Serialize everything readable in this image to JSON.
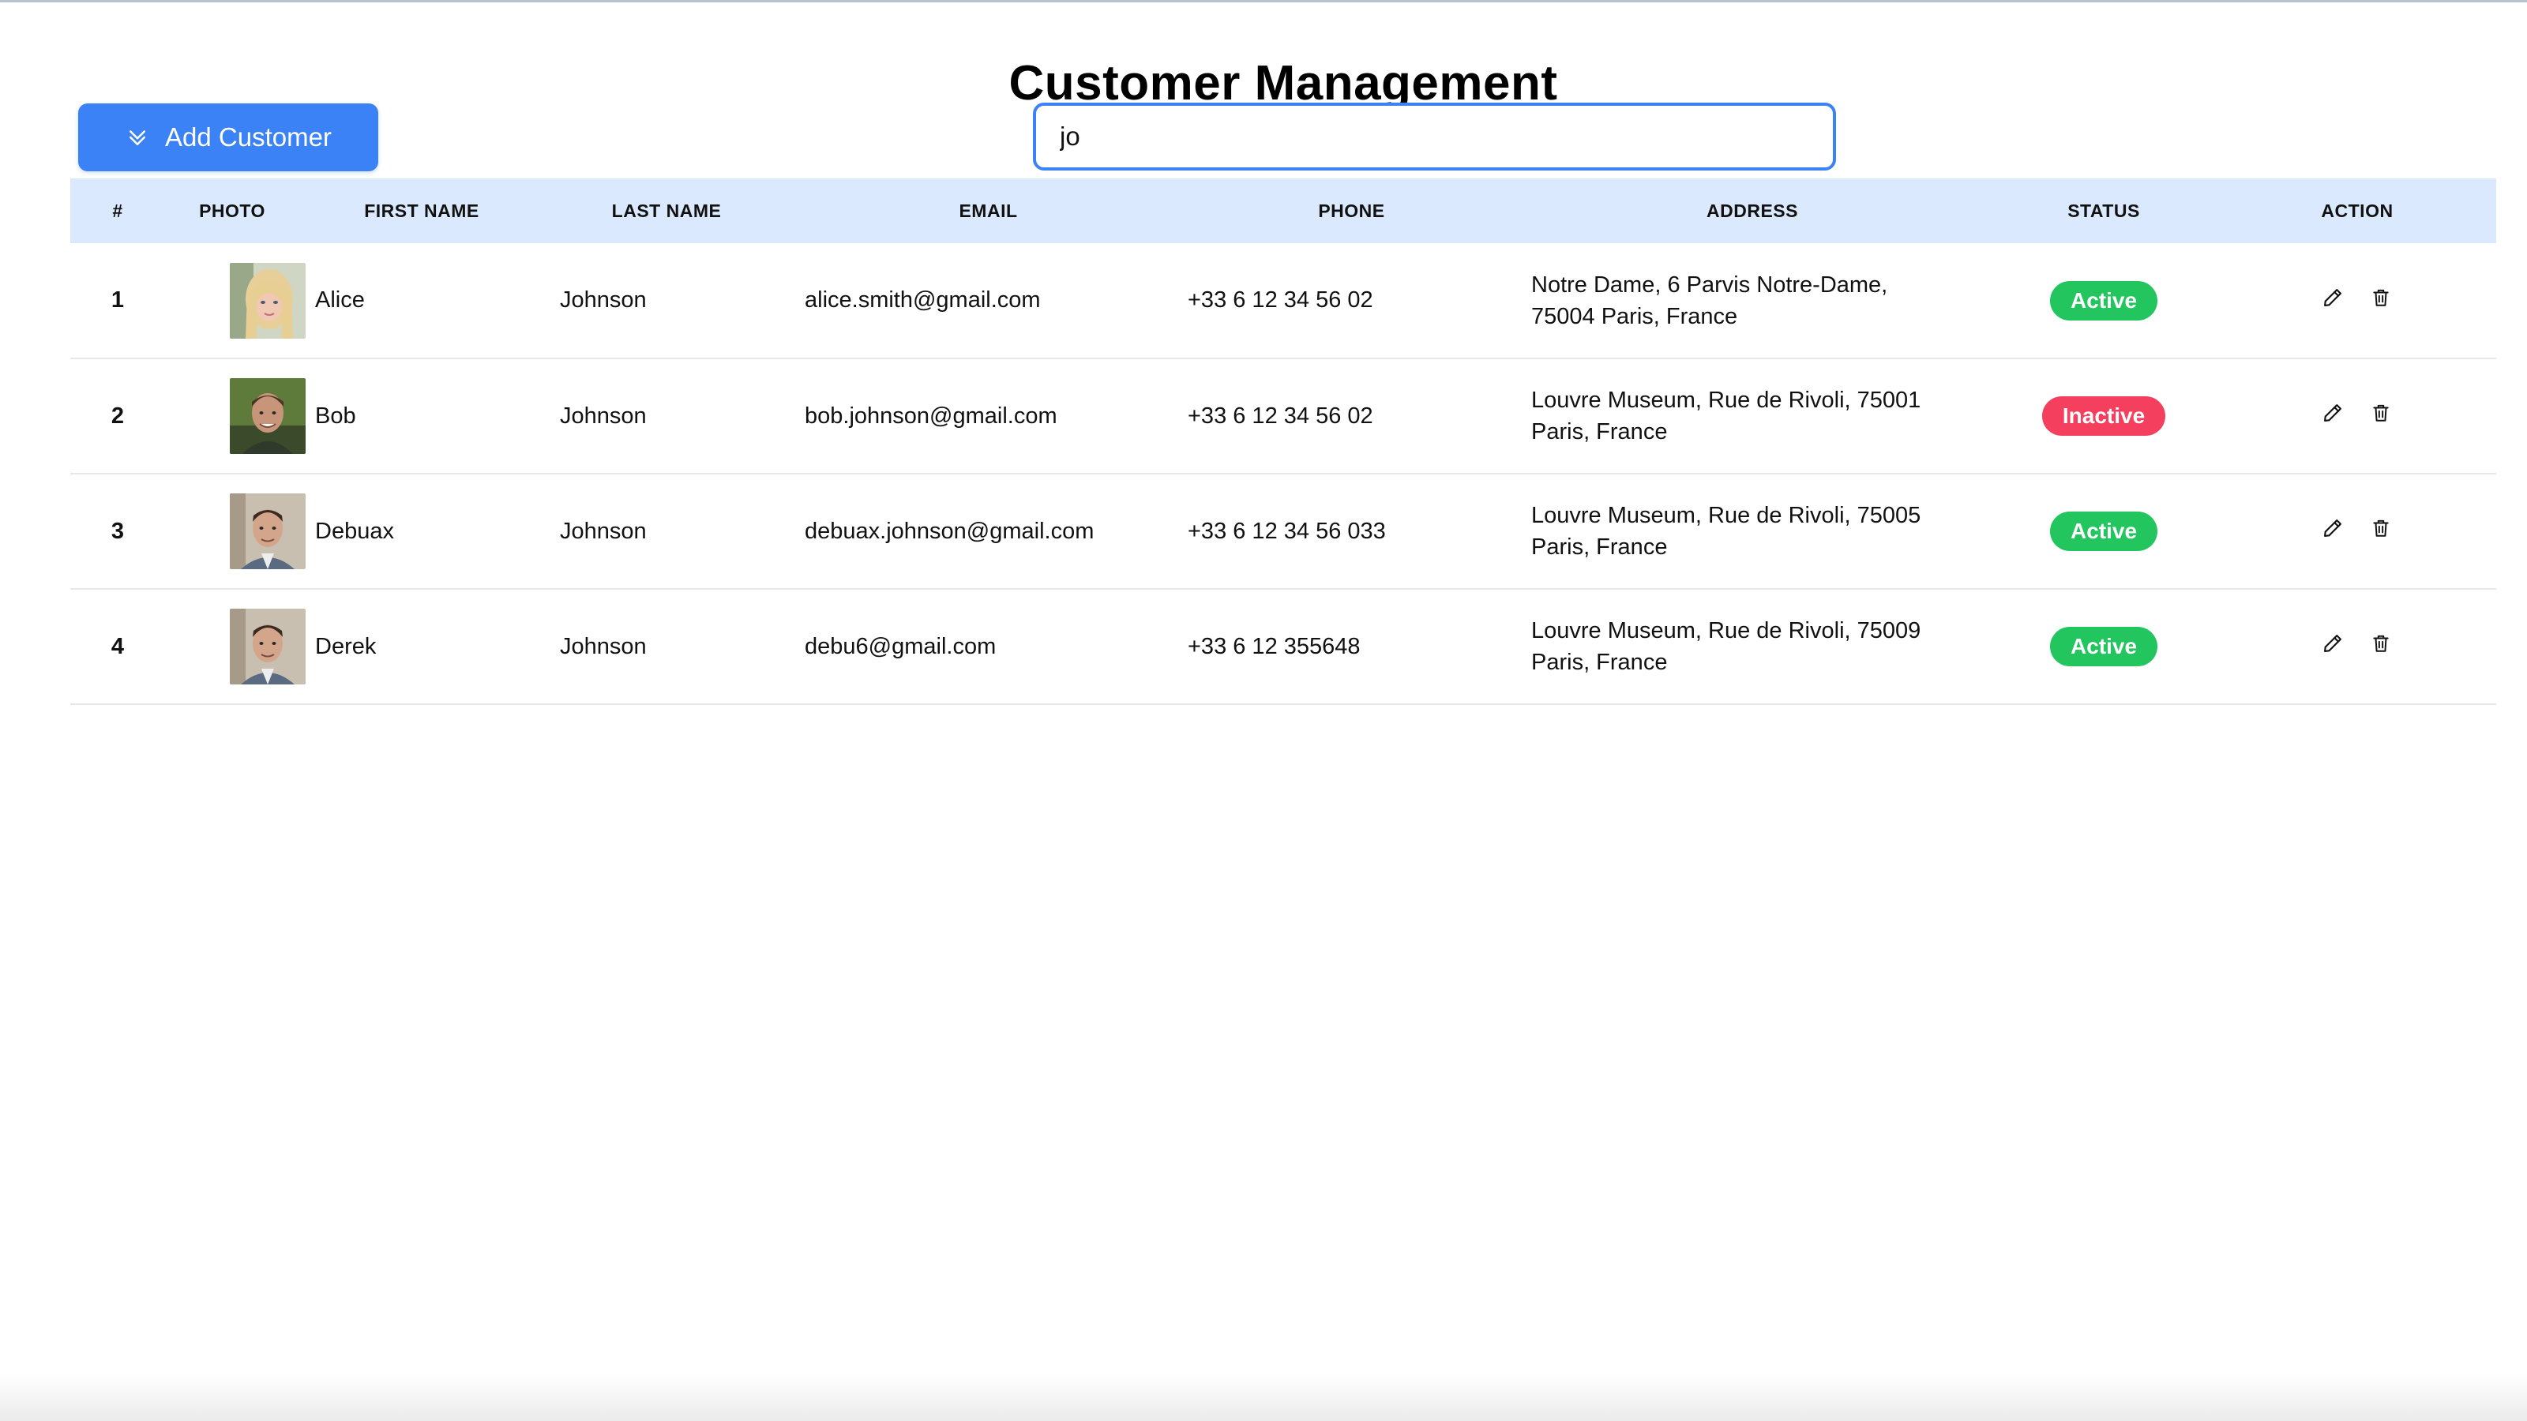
{
  "page": {
    "title": "Customer Management"
  },
  "toolbar": {
    "add_label": "Add Customer",
    "add_icon": "chevrons-down-icon"
  },
  "search": {
    "value": "jo"
  },
  "table": {
    "headers": [
      "#",
      "PHOTO",
      "FIRST NAME",
      "LAST NAME",
      "EMAIL",
      "PHONE",
      "ADDRESS",
      "STATUS",
      "ACTION"
    ],
    "rows": [
      {
        "index": "1",
        "first_name": "Alice",
        "last_name": "Johnson",
        "email": "alice.smith@gmail.com",
        "phone": "+33 6 12 34 56 02",
        "address_line1": "Notre Dame, 6 Parvis Notre-Dame,",
        "address_line2": "75004 Paris, France",
        "status": "Active"
      },
      {
        "index": "2",
        "first_name": "Bob",
        "last_name": "Johnson",
        "email": "bob.johnson@gmail.com",
        "phone": "+33 6 12 34 56 02",
        "address_line1": "Louvre Museum, Rue de Rivoli, 75001",
        "address_line2": "Paris, France",
        "status": "Inactive"
      },
      {
        "index": "3",
        "first_name": "Debuax",
        "last_name": "Johnson",
        "email": "debuax.johnson@gmail.com",
        "phone": "+33 6 12 34 56 033",
        "address_line1": "Louvre Museum, Rue de Rivoli, 75005",
        "address_line2": "Paris, France",
        "status": "Active"
      },
      {
        "index": "4",
        "first_name": "Derek",
        "last_name": "Johnson",
        "email": "debu6@gmail.com",
        "phone": "+33 6 12 355648",
        "address_line1": "Louvre Museum, Rue de Rivoli, 75009",
        "address_line2": "Paris, France",
        "status": "Active"
      }
    ]
  },
  "colors": {
    "accent": "#3b82f6",
    "header_bg": "#dbe9fe",
    "status_active": "#22c55e",
    "status_inactive": "#f43f5e"
  },
  "icons": {
    "edit": "pencil-icon",
    "delete": "trash-icon"
  }
}
